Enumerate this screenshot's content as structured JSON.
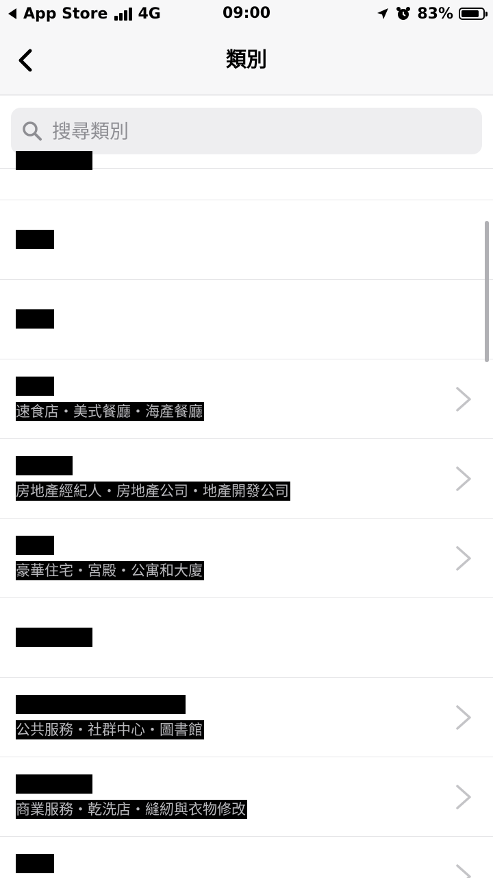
{
  "status_bar": {
    "back_label": "App Store",
    "network": "4G",
    "time": "09:00",
    "battery_percent": "83%",
    "battery_level": 0.83
  },
  "nav": {
    "title": "類別"
  },
  "search": {
    "placeholder": "搜尋類別",
    "value": ""
  },
  "list": {
    "items": [
      {
        "subtitle": "",
        "has_chevron": false
      },
      {
        "subtitle": "",
        "has_chevron": false
      },
      {
        "subtitle": "",
        "has_chevron": false
      },
      {
        "subtitle": "速食店・美式餐廳・海產餐廳",
        "has_chevron": true
      },
      {
        "subtitle": "房地產經紀人・房地產公司・地產開發公司",
        "has_chevron": true
      },
      {
        "subtitle": "豪華住宅・宮殿・公寓和大廈",
        "has_chevron": true
      },
      {
        "subtitle": "",
        "has_chevron": false
      },
      {
        "subtitle": "公共服務・社群中心・圖書館",
        "has_chevron": true
      },
      {
        "subtitle": "商業服務・乾洗店・縫紉與衣物修改",
        "has_chevron": true
      },
      {
        "subtitle": "",
        "has_chevron": true
      }
    ]
  }
}
